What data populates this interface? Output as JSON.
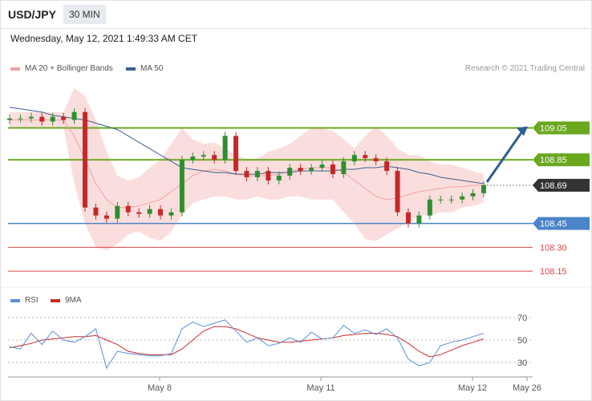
{
  "header": {
    "symbol": "USD/JPY",
    "timeframe": "30 MIN",
    "datetime": "Wednesday, May 12, 2021 1:49:33 AM CET",
    "credit": "Research © 2021 Trading Central"
  },
  "legend": {
    "ma20_label": "MA 20 + Bollinger Bands",
    "ma50_label": "MA 50",
    "rsi_label": "RSI",
    "ma9_label": "9MA"
  },
  "colors": {
    "bollinger": "#f2a0a0",
    "ma50": "#3a5f8f",
    "resistance": "#6aa81e",
    "support": "#4b84c9",
    "secondary_support": "#d94545",
    "current": "#333333",
    "rsi": "#5b8ed6",
    "ma9": "#cc2a2a",
    "candle_up": "#2f8f2f",
    "candle_down": "#c62828",
    "arrow": "#2f5c94"
  },
  "chart_data": [
    {
      "type": "candlestick",
      "title": "USD/JPY",
      "x_tick_labels": [
        "May 8",
        "May 11",
        "May 12",
        "May 26"
      ],
      "ylim": [
        108.08,
        109.35
      ],
      "current_price": 108.69,
      "levels": [
        {
          "label": "109.05",
          "value": 109.05,
          "kind": "resistance"
        },
        {
          "label": "108.85",
          "value": 108.85,
          "kind": "resistance"
        },
        {
          "label": "108.69",
          "value": 108.69,
          "kind": "current"
        },
        {
          "label": "108.45",
          "value": 108.45,
          "kind": "support"
        },
        {
          "label": "108.30",
          "value": 108.3,
          "kind": "secondary_support"
        },
        {
          "label": "108.15",
          "value": 108.15,
          "kind": "secondary_support"
        }
      ],
      "forecast_arrow": {
        "from": 108.71,
        "to": 109.06
      },
      "series": [
        {
          "name": "MA 50",
          "values": [
            109.18,
            109.17,
            109.16,
            109.15,
            109.13,
            109.12,
            109.11,
            109.1,
            109.08,
            109.06,
            109.04,
            109.0,
            108.96,
            108.92,
            108.88,
            108.84,
            108.8,
            108.79,
            108.78,
            108.77,
            108.77,
            108.76,
            108.76,
            108.76,
            108.77,
            108.77,
            108.77,
            108.78,
            108.78,
            108.78,
            108.78,
            108.79,
            108.79,
            108.8,
            108.8,
            108.81,
            108.8,
            108.79,
            108.77,
            108.76,
            108.74,
            108.73,
            108.72,
            108.71,
            108.7
          ]
        },
        {
          "name": "MA 20",
          "values": [
            109.1,
            109.1,
            109.1,
            109.1,
            109.1,
            109.1,
            109.0,
            108.85,
            108.7,
            108.6,
            108.55,
            108.55,
            108.56,
            108.58,
            108.6,
            108.65,
            108.7,
            108.75,
            108.78,
            108.79,
            108.78,
            108.76,
            108.75,
            108.75,
            108.75,
            108.76,
            108.78,
            108.79,
            108.8,
            108.8,
            108.8,
            108.77,
            108.72,
            108.67,
            108.62,
            108.6,
            108.61,
            108.63,
            108.65,
            108.66,
            108.67,
            108.68,
            108.68,
            108.69,
            108.69
          ]
        },
        {
          "name": "Bollinger Upper",
          "values": [
            109.15,
            109.15,
            109.15,
            109.15,
            109.15,
            109.15,
            109.3,
            109.25,
            109.1,
            108.9,
            108.75,
            108.72,
            108.74,
            108.8,
            108.85,
            108.95,
            109.05,
            108.98,
            108.95,
            108.96,
            108.92,
            108.88,
            108.85,
            108.86,
            108.9,
            108.92,
            108.95,
            109.0,
            109.05,
            109.05,
            109.03,
            108.98,
            108.92,
            109.0,
            109.06,
            109.0,
            108.92,
            108.88,
            108.88,
            108.84,
            108.82,
            108.82,
            108.8,
            108.78,
            108.76
          ]
        },
        {
          "name": "Bollinger Lower",
          "values": [
            109.05,
            109.05,
            109.05,
            109.05,
            109.05,
            109.05,
            108.7,
            108.45,
            108.3,
            108.28,
            108.32,
            108.38,
            108.4,
            108.36,
            108.34,
            108.4,
            108.5,
            108.58,
            108.6,
            108.62,
            108.62,
            108.6,
            108.6,
            108.62,
            108.6,
            108.6,
            108.62,
            108.62,
            108.6,
            108.6,
            108.6,
            108.52,
            108.45,
            108.35,
            108.34,
            108.38,
            108.42,
            108.45,
            108.5,
            108.5,
            108.52,
            108.52,
            108.55,
            108.56,
            108.58
          ]
        },
        {
          "name": "Price",
          "values": [
            109.11,
            109.11,
            109.12,
            109.09,
            109.12,
            109.1,
            109.15,
            108.55,
            108.5,
            108.48,
            108.56,
            108.52,
            108.51,
            108.54,
            108.5,
            108.52,
            108.85,
            108.87,
            108.88,
            108.85,
            109.0,
            108.78,
            108.74,
            108.78,
            108.72,
            108.75,
            108.8,
            108.78,
            108.8,
            108.82,
            108.76,
            108.84,
            108.88,
            108.86,
            108.84,
            108.78,
            108.52,
            108.45,
            108.5,
            108.6,
            108.6,
            108.6,
            108.62,
            108.64,
            108.69
          ]
        }
      ]
    },
    {
      "type": "line",
      "title": "RSI",
      "y_tick_labels": [
        "70",
        "50",
        "30"
      ],
      "ylim": [
        20,
        80
      ],
      "series": [
        {
          "name": "RSI",
          "values": [
            44,
            42,
            56,
            46,
            58,
            50,
            48,
            53,
            60,
            25,
            40,
            38,
            37,
            36,
            36,
            38,
            60,
            66,
            62,
            65,
            68,
            58,
            48,
            52,
            45,
            47,
            52,
            48,
            57,
            51,
            52,
            63,
            56,
            59,
            55,
            60,
            52,
            33,
            27,
            30,
            45,
            48,
            50,
            53,
            56
          ]
        },
        {
          "name": "9MA",
          "values": [
            43,
            45,
            47,
            50,
            51,
            52,
            53,
            53,
            54,
            50,
            46,
            40,
            38,
            37,
            37,
            37,
            42,
            50,
            58,
            62,
            62,
            60,
            56,
            52,
            50,
            48,
            48,
            49,
            50,
            51,
            52,
            54,
            55,
            56,
            56,
            55,
            53,
            47,
            40,
            35,
            37,
            41,
            45,
            48,
            51
          ]
        }
      ]
    }
  ]
}
